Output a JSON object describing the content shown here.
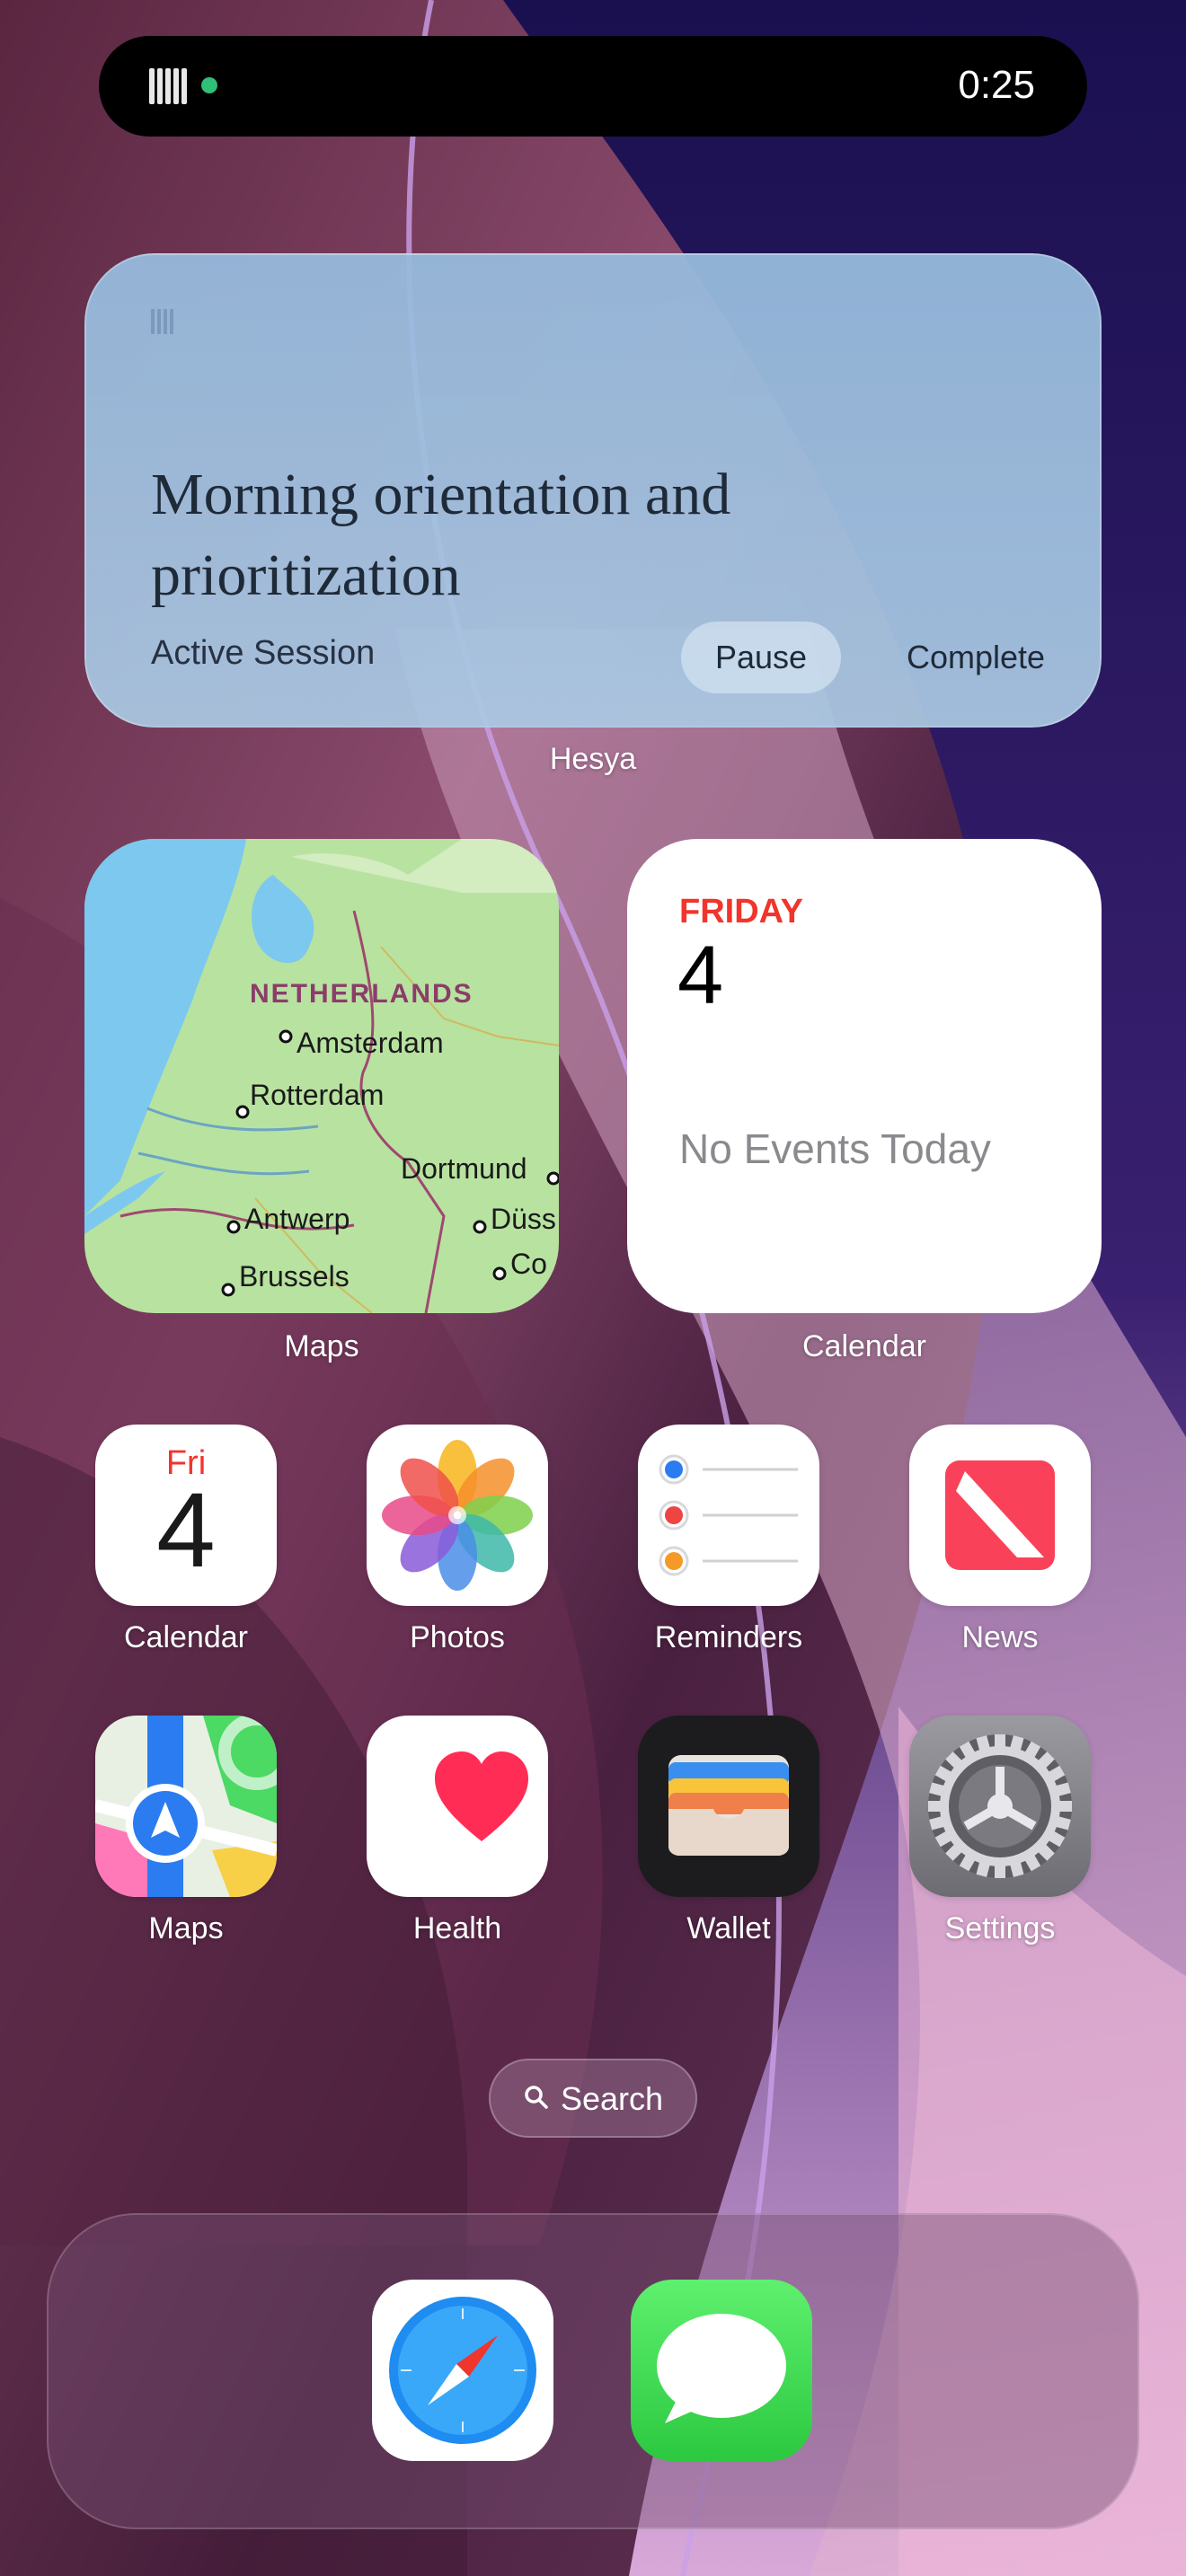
{
  "status": {
    "time": "0:25"
  },
  "hesya_widget": {
    "title": "Morning orientation and prioritization",
    "status_text": "Active Session",
    "pause_label": "Pause",
    "complete_label": "Complete",
    "widget_label": "Hesya"
  },
  "maps_widget": {
    "widget_label": "Maps",
    "country": "NETHERLANDS",
    "cities": [
      "Amsterdam",
      "Rotterdam",
      "Dortmund",
      "Antwerp",
      "Düss",
      "Brussels",
      "Co"
    ]
  },
  "calendar_widget": {
    "widget_label": "Calendar",
    "day_name": "FRIDAY",
    "date": "4",
    "no_events": "No Events Today"
  },
  "apps_row1": [
    {
      "label": "Calendar",
      "icon": "calendar-icon",
      "dow": "Fri",
      "date": "4"
    },
    {
      "label": "Photos",
      "icon": "photos-icon"
    },
    {
      "label": "Reminders",
      "icon": "reminders-icon"
    },
    {
      "label": "News",
      "icon": "news-icon"
    }
  ],
  "apps_row2": [
    {
      "label": "Maps",
      "icon": "maps-icon"
    },
    {
      "label": "Health",
      "icon": "health-icon"
    },
    {
      "label": "Wallet",
      "icon": "wallet-icon"
    },
    {
      "label": "Settings",
      "icon": "settings-icon"
    }
  ],
  "search": {
    "label": "Search"
  },
  "dock": [
    {
      "icon": "safari-icon"
    },
    {
      "icon": "messages-icon"
    }
  ]
}
